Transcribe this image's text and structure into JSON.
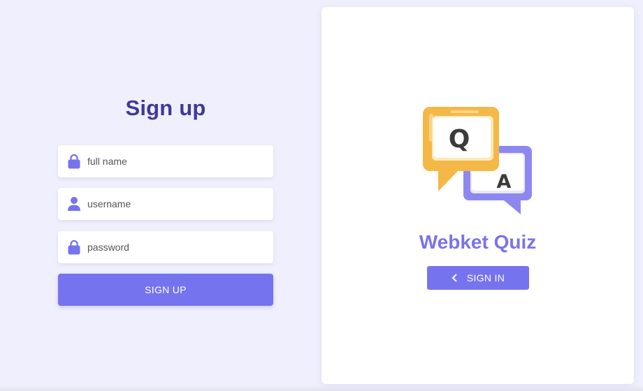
{
  "signup": {
    "title": "Sign up",
    "fields": [
      {
        "placeholder": "full name",
        "icon": "lock-icon"
      },
      {
        "placeholder": "username",
        "icon": "user-icon"
      },
      {
        "placeholder": "password",
        "icon": "lock-icon"
      }
    ],
    "submit_label": "SIGN UP"
  },
  "panel": {
    "illustration": {
      "q_letter": "Q",
      "a_letter": "A"
    },
    "brand": "Webket Quiz",
    "signin_label": "SIGN IN",
    "signin_icon": "chevron-left-icon"
  },
  "colors": {
    "background": "#efeffd",
    "accent": "#7673ee",
    "title": "#40399a",
    "brand": "#7a74ea",
    "bubble_yellow": "#f4b846",
    "bubble_purple": "#8d88f0"
  }
}
